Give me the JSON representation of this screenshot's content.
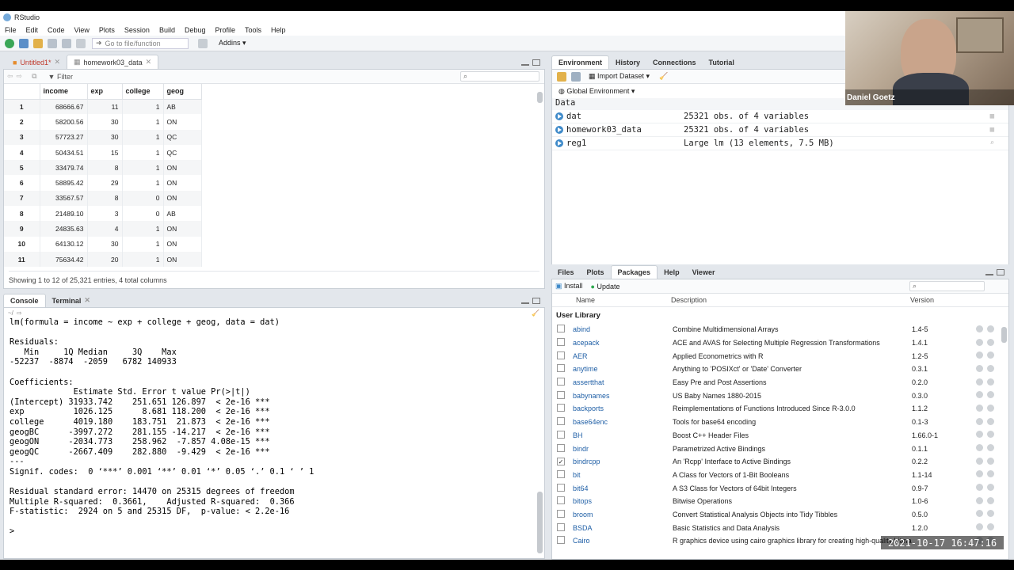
{
  "window": {
    "title": "RStudio"
  },
  "menu": [
    "File",
    "Edit",
    "Code",
    "View",
    "Plots",
    "Session",
    "Build",
    "Debug",
    "Profile",
    "Tools",
    "Help"
  ],
  "toolbar": {
    "goto_placeholder": "Go to file/function",
    "addins": "Addins"
  },
  "source": {
    "tabs": [
      {
        "label": "Untitled1*"
      },
      {
        "label": "homework03_data"
      }
    ],
    "filter_label": "Filter",
    "columns": [
      "income",
      "exp",
      "college",
      "geog"
    ],
    "rows": [
      [
        "1",
        "68666.67",
        "11",
        "1",
        "AB"
      ],
      [
        "2",
        "58200.56",
        "30",
        "1",
        "ON"
      ],
      [
        "3",
        "57723.27",
        "30",
        "1",
        "QC"
      ],
      [
        "4",
        "50434.51",
        "15",
        "1",
        "QC"
      ],
      [
        "5",
        "33479.74",
        "8",
        "1",
        "ON"
      ],
      [
        "6",
        "58895.42",
        "29",
        "1",
        "ON"
      ],
      [
        "7",
        "33567.57",
        "8",
        "0",
        "ON"
      ],
      [
        "8",
        "21489.10",
        "3",
        "0",
        "AB"
      ],
      [
        "9",
        "24835.63",
        "4",
        "1",
        "ON"
      ],
      [
        "10",
        "64130.12",
        "30",
        "1",
        "ON"
      ],
      [
        "11",
        "75634.42",
        "20",
        "1",
        "ON"
      ]
    ],
    "status": "Showing 1 to 12 of 25,321 entries, 4 total columns"
  },
  "console": {
    "tabs": [
      "Console",
      "Terminal"
    ],
    "path": "~/",
    "lines": [
      "lm(formula = income ~ exp + college + geog, data = dat)",
      "",
      "Residuals:",
      "   Min     1Q Median     3Q    Max ",
      "-52237  -8874  -2059   6782 140933 ",
      "",
      "Coefficients:",
      "             Estimate Std. Error t value Pr(>|t|)    ",
      "(Intercept) 31933.742    251.651 126.897  < 2e-16 ***",
      "exp          1026.125      8.681 118.200  < 2e-16 ***",
      "college      4019.180    183.751  21.873  < 2e-16 ***",
      "geogBC      -3997.272    281.155 -14.217  < 2e-16 ***",
      "geogON      -2034.773    258.962  -7.857 4.08e-15 ***",
      "geogQC      -2667.409    282.880  -9.429  < 2e-16 ***",
      "---",
      "Signif. codes:  0 ‘***’ 0.001 ‘**’ 0.01 ‘*’ 0.05 ‘.’ 0.1 ‘ ’ 1",
      "",
      "Residual standard error: 14470 on 25315 degrees of freedom",
      "Multiple R-squared:  0.3661,\tAdjusted R-squared:  0.366 ",
      "F-statistic:  2924 on 5 and 25315 DF,  p-value: < 2.2e-16",
      "",
      "> "
    ]
  },
  "environment": {
    "tabs": [
      "Environment",
      "History",
      "Connections",
      "Tutorial"
    ],
    "import_label": "Import Dataset",
    "scope": "Global Environment",
    "section": "Data",
    "items": [
      {
        "name": "dat",
        "value": "25321 obs. of 4 variables"
      },
      {
        "name": "homework03_data",
        "value": "25321 obs. of 4 variables"
      },
      {
        "name": "reg1",
        "value": "Large lm (13 elements, 7.5 MB)"
      }
    ]
  },
  "packages": {
    "tabs": [
      "Files",
      "Plots",
      "Packages",
      "Help",
      "Viewer"
    ],
    "install_label": "Install",
    "update_label": "Update",
    "headers": [
      "Name",
      "Description",
      "Version"
    ],
    "section": "User Library",
    "items": [
      {
        "checked": false,
        "name": "abind",
        "desc": "Combine Multidimensional Arrays",
        "ver": "1.4-5"
      },
      {
        "checked": false,
        "name": "acepack",
        "desc": "ACE and AVAS for Selecting Multiple Regression Transformations",
        "ver": "1.4.1"
      },
      {
        "checked": false,
        "name": "AER",
        "desc": "Applied Econometrics with R",
        "ver": "1.2-5"
      },
      {
        "checked": false,
        "name": "anytime",
        "desc": "Anything to 'POSIXct' or 'Date' Converter",
        "ver": "0.3.1"
      },
      {
        "checked": false,
        "name": "assertthat",
        "desc": "Easy Pre and Post Assertions",
        "ver": "0.2.0"
      },
      {
        "checked": false,
        "name": "babynames",
        "desc": "US Baby Names 1880-2015",
        "ver": "0.3.0"
      },
      {
        "checked": false,
        "name": "backports",
        "desc": "Reimplementations of Functions Introduced Since R-3.0.0",
        "ver": "1.1.2"
      },
      {
        "checked": false,
        "name": "base64enc",
        "desc": "Tools for base64 encoding",
        "ver": "0.1-3"
      },
      {
        "checked": false,
        "name": "BH",
        "desc": "Boost C++ Header Files",
        "ver": "1.66.0-1"
      },
      {
        "checked": false,
        "name": "bindr",
        "desc": "Parametrized Active Bindings",
        "ver": "0.1.1"
      },
      {
        "checked": true,
        "name": "bindrcpp",
        "desc": "An 'Rcpp' Interface to Active Bindings",
        "ver": "0.2.2"
      },
      {
        "checked": false,
        "name": "bit",
        "desc": "A Class for Vectors of 1-Bit Booleans",
        "ver": "1.1-14"
      },
      {
        "checked": false,
        "name": "bit64",
        "desc": "A S3 Class for Vectors of 64bit Integers",
        "ver": "0.9-7"
      },
      {
        "checked": false,
        "name": "bitops",
        "desc": "Bitwise Operations",
        "ver": "1.0-6"
      },
      {
        "checked": false,
        "name": "broom",
        "desc": "Convert Statistical Analysis Objects into Tidy Tibbles",
        "ver": "0.5.0"
      },
      {
        "checked": false,
        "name": "BSDA",
        "desc": "Basic Statistics and Data Analysis",
        "ver": "1.2.0"
      },
      {
        "checked": false,
        "name": "Cairo",
        "desc": "R graphics device using cairo graphics library for creating high-quality bitmap (PNG, JPEG, TIFF), vector (PDF, SVG, PostScript) and",
        "ver": ""
      }
    ]
  },
  "webcam": {
    "name": "Daniel Goetz"
  },
  "timestamp": "2021-10-17 16:47:16"
}
